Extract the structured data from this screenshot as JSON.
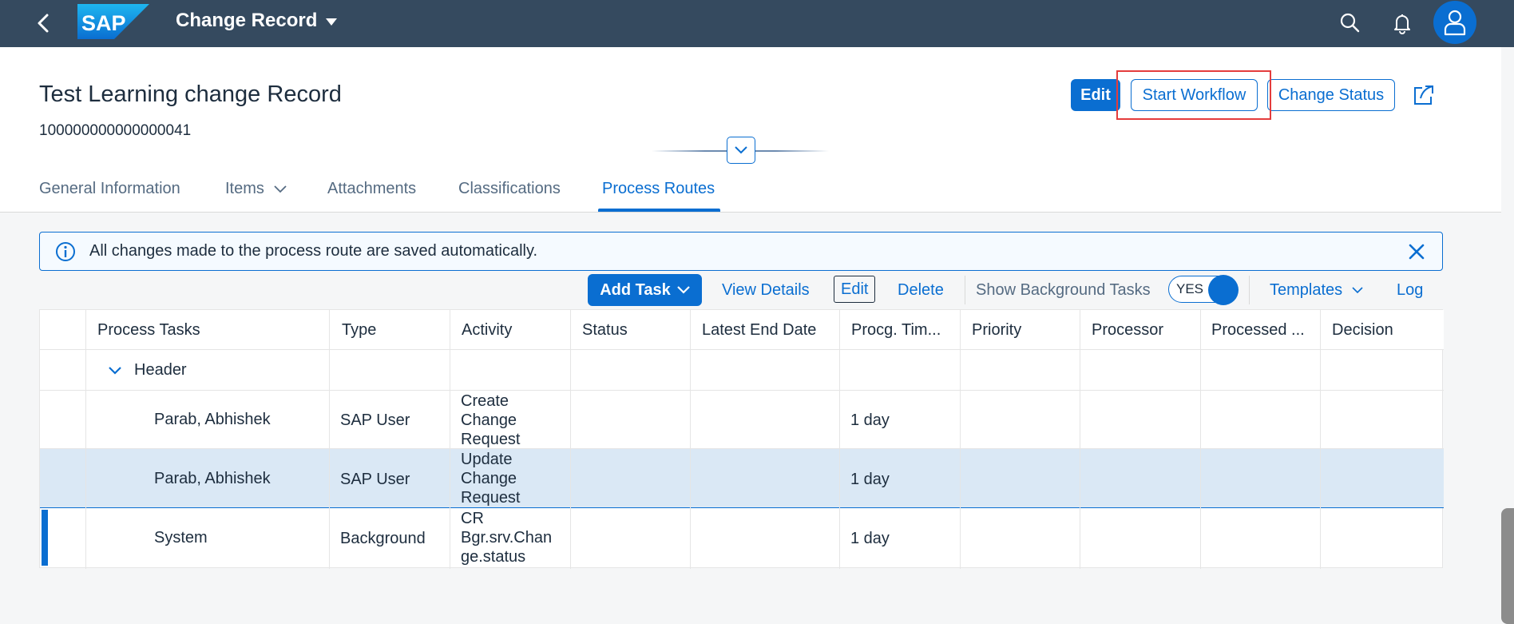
{
  "shell": {
    "title": "Change Record",
    "logo_text": "SAP",
    "icons": {
      "back": "back-icon",
      "dropdown": "chevron-down-icon",
      "search": "search-icon",
      "notifications": "bell-icon",
      "user": "user-icon"
    }
  },
  "header": {
    "title": "Test Learning change Record",
    "object_id": "100000000000000041",
    "actions": {
      "edit": "Edit",
      "start_workflow": "Start Workflow",
      "change_status": "Change Status"
    }
  },
  "tabs": [
    {
      "label": "General Information"
    },
    {
      "label": "Items"
    },
    {
      "label": "Attachments"
    },
    {
      "label": "Classifications"
    },
    {
      "label": "Process Routes"
    }
  ],
  "active_tab": "Process Routes",
  "info_strip": {
    "text": "All changes made to the process route are saved automatically."
  },
  "toolbar": {
    "add_task": "Add Task",
    "view_details": "View Details",
    "edit": "Edit",
    "delete": "Delete",
    "show_background_tasks": "Show Background Tasks",
    "switch_state": "YES",
    "templates": "Templates",
    "log": "Log"
  },
  "table": {
    "columns": [
      "Process Tasks",
      "Type",
      "Activity",
      "Status",
      "Latest End Date",
      "Procg. Tim...",
      "Priority",
      "Processor",
      "Processed ...",
      "Decision"
    ],
    "group": "Header",
    "rows": [
      {
        "task": "Parab, Abhishek",
        "type": "SAP User",
        "activity": [
          "Create",
          "Change",
          "Request"
        ],
        "procg_time": "1 day"
      },
      {
        "task": "Parab, Abhishek",
        "type": "SAP User",
        "activity": [
          "Update",
          "Change",
          "Request"
        ],
        "procg_time": "1 day",
        "selected": true
      },
      {
        "task": "System",
        "type": "Background",
        "activity": [
          "CR",
          "Bgr.srv.Chan",
          "ge.status"
        ],
        "procg_time": "1 day"
      }
    ]
  },
  "colors": {
    "shell": "#354a5f",
    "accent": "#0a6ed1",
    "highlight": "#e43c3c",
    "selected_row": "#dae8f5"
  }
}
